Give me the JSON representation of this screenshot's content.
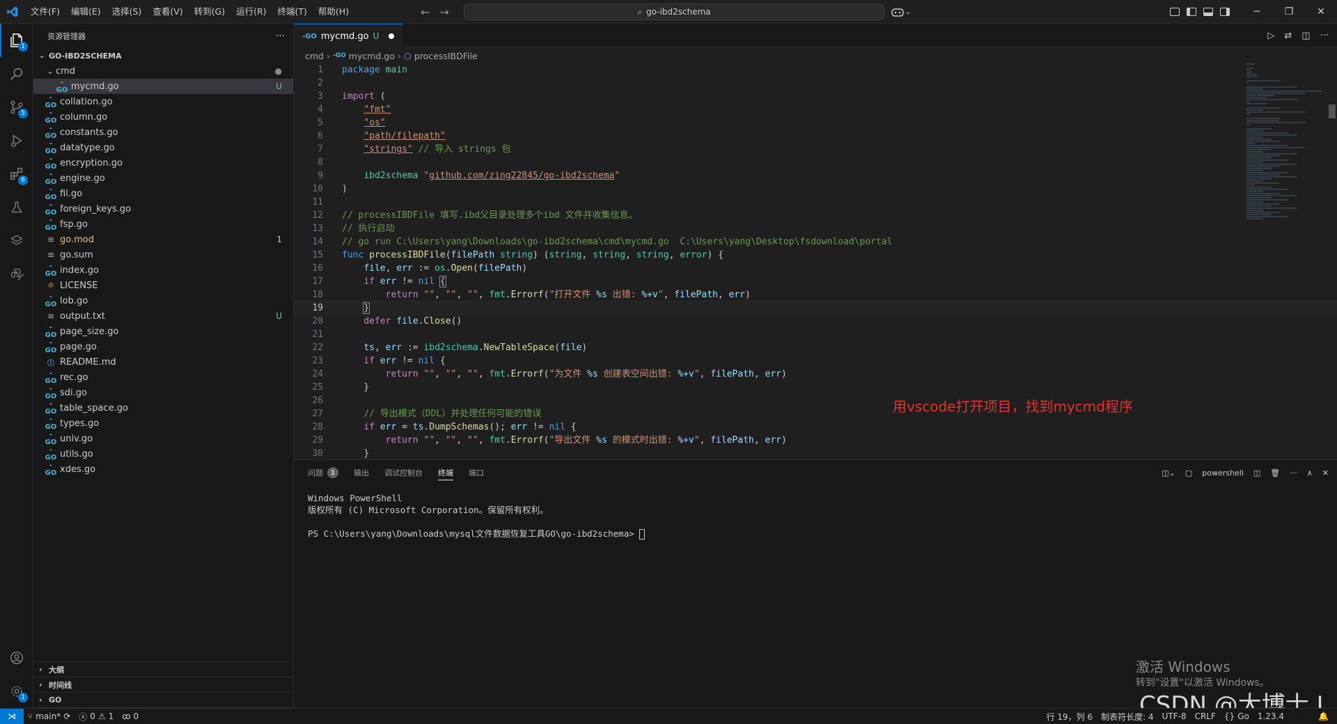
{
  "titlebar": {
    "menu": [
      "文件(F)",
      "编辑(E)",
      "选择(S)",
      "查看(V)",
      "转到(G)",
      "运行(R)",
      "终端(T)",
      "帮助(H)"
    ],
    "search_text": "go-ibd2schema"
  },
  "activity_badges": {
    "explorer": "1",
    "scm": "5",
    "extensions": "6",
    "accounts": "1"
  },
  "sidebar": {
    "header": "资源管理器",
    "more": "···",
    "root": "GO-IBD2SCHEMA",
    "folder": "cmd",
    "files": [
      {
        "name": "mycmd.go",
        "status": "U",
        "indent": 2,
        "icon": "go"
      },
      {
        "name": "collation.go",
        "status": "",
        "indent": 1,
        "icon": "go"
      },
      {
        "name": "column.go",
        "status": "",
        "indent": 1,
        "icon": "go"
      },
      {
        "name": "constants.go",
        "status": "",
        "indent": 1,
        "icon": "go"
      },
      {
        "name": "datatype.go",
        "status": "",
        "indent": 1,
        "icon": "go"
      },
      {
        "name": "encryption.go",
        "status": "",
        "indent": 1,
        "icon": "go"
      },
      {
        "name": "engine.go",
        "status": "",
        "indent": 1,
        "icon": "go"
      },
      {
        "name": "fil.go",
        "status": "",
        "indent": 1,
        "icon": "go"
      },
      {
        "name": "foreign_keys.go",
        "status": "",
        "indent": 1,
        "icon": "go"
      },
      {
        "name": "fsp.go",
        "status": "",
        "indent": 1,
        "icon": "go"
      },
      {
        "name": "go.mod",
        "status": "1",
        "indent": 1,
        "icon": "plain"
      },
      {
        "name": "go.sum",
        "status": "",
        "indent": 1,
        "icon": "plain"
      },
      {
        "name": "index.go",
        "status": "",
        "indent": 1,
        "icon": "go"
      },
      {
        "name": "LICENSE",
        "status": "",
        "indent": 1,
        "icon": "lic"
      },
      {
        "name": "lob.go",
        "status": "",
        "indent": 1,
        "icon": "go"
      },
      {
        "name": "output.txt",
        "status": "U",
        "indent": 1,
        "icon": "plain"
      },
      {
        "name": "page_size.go",
        "status": "",
        "indent": 1,
        "icon": "go"
      },
      {
        "name": "page.go",
        "status": "",
        "indent": 1,
        "icon": "go"
      },
      {
        "name": "README.md",
        "status": "",
        "indent": 1,
        "icon": "info"
      },
      {
        "name": "rec.go",
        "status": "",
        "indent": 1,
        "icon": "go"
      },
      {
        "name": "sdi.go",
        "status": "",
        "indent": 1,
        "icon": "go"
      },
      {
        "name": "table_space.go",
        "status": "",
        "indent": 1,
        "icon": "go"
      },
      {
        "name": "types.go",
        "status": "",
        "indent": 1,
        "icon": "go"
      },
      {
        "name": "univ.go",
        "status": "",
        "indent": 1,
        "icon": "go"
      },
      {
        "name": "utils.go",
        "status": "",
        "indent": 1,
        "icon": "go"
      },
      {
        "name": "xdes.go",
        "status": "",
        "indent": 1,
        "icon": "go"
      }
    ],
    "bottom_sections": [
      "大纲",
      "时间线",
      "GO"
    ]
  },
  "tab": {
    "name": "mycmd.go",
    "status": "U"
  },
  "breadcrumb": {
    "folder": "cmd",
    "file": "mycmd.go",
    "symbol": "processIBDFile"
  },
  "annotation": "用vscode打开项目，找到mycmd程序",
  "panel": {
    "tabs": [
      "问题",
      "输出",
      "调试控制台",
      "终端",
      "端口"
    ],
    "problems_badge": "1",
    "shell": "powershell",
    "terminal_lines": [
      "Windows PowerShell",
      "版权所有 (C) Microsoft Corporation。保留所有权利。",
      "",
      "PS C:\\Users\\yang\\Downloads\\mysql文件数据恢复工具GO\\go-ibd2schema> "
    ]
  },
  "watermark": {
    "line1": "激活 Windows",
    "line2": "转到\"设置\"以激活 Windows。",
    "csdn": "CSDN @大博士.J"
  },
  "statusbar": {
    "branch": "main*",
    "errors": "0",
    "warnings": "1",
    "ports": "0",
    "position": "行 19，列 6",
    "tabsize": "制表符长度: 4",
    "encoding": "UTF-8",
    "eol": "CRLF",
    "language": "Go",
    "go_version": "1.23.4"
  },
  "colors": {
    "accent": "#0078d4",
    "annotation": "#e8312a",
    "untracked": "#73c991",
    "modified": "#e2c08d"
  }
}
